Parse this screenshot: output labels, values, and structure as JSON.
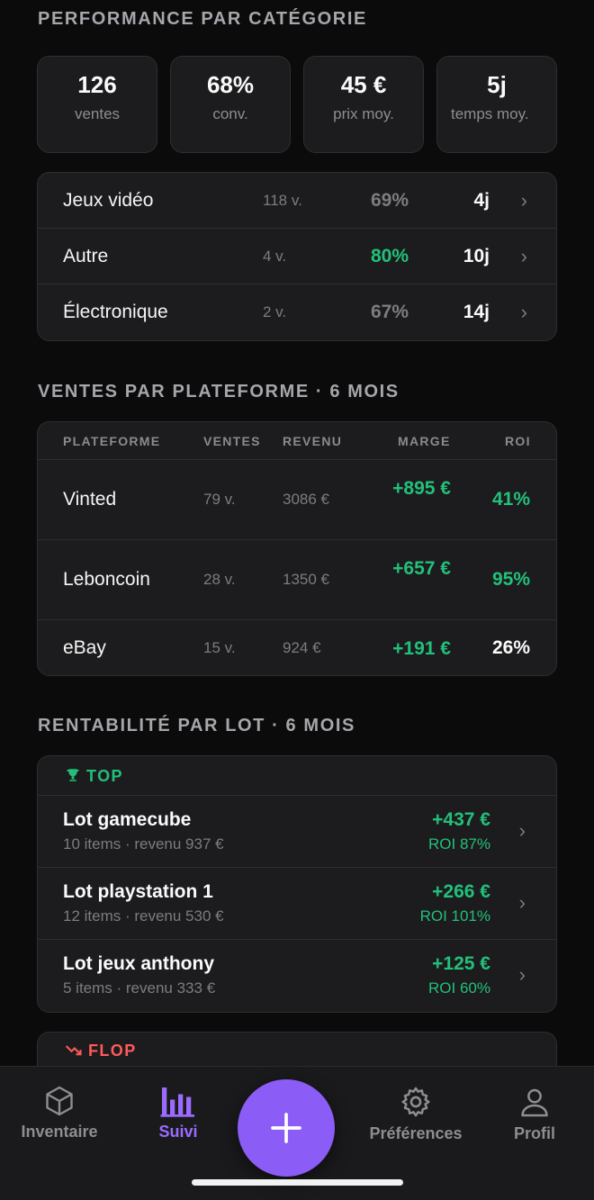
{
  "colors": {
    "accent": "#8b5cf6",
    "positive": "#22c07a",
    "negative": "#ff5a5a",
    "background": "#0b0b0c",
    "card": "#1c1c1e"
  },
  "perf": {
    "title": "PERFORMANCE PAR CATÉGORIE",
    "kpis": [
      {
        "value": "126",
        "label": "ventes"
      },
      {
        "value": "68%",
        "label": "conv."
      },
      {
        "value": "45 €",
        "label": "prix moy."
      },
      {
        "value": "5j",
        "label": "temps moy."
      }
    ],
    "categories": [
      {
        "name": "Jeux vidéo",
        "count": "118 v.",
        "pct": "69%",
        "days": "4j"
      },
      {
        "name": "Autre",
        "count": "4 v.",
        "pct": "80%",
        "days": "10j"
      },
      {
        "name": "Électronique",
        "count": "2 v.",
        "pct": "67%",
        "days": "14j"
      }
    ]
  },
  "platforms": {
    "title": "VENTES PAR PLATEFORME · 6 MOIS",
    "headers": {
      "platform": "PLATEFORME",
      "sales": "VENTES",
      "revenue": "REVENU",
      "margin": "MARGE",
      "roi": "ROI"
    },
    "rows": [
      {
        "name": "Vinted",
        "sales": "79 v.",
        "revenue": "3086 €",
        "margin": "+895 €",
        "roi": "41%"
      },
      {
        "name": "Leboncoin",
        "sales": "28 v.",
        "revenue": "1350 €",
        "margin": "+657 €",
        "roi": "95%"
      },
      {
        "name": "eBay",
        "sales": "15 v.",
        "revenue": "924 €",
        "margin": "+191 €",
        "roi": "26%"
      }
    ]
  },
  "lots": {
    "title": "RENTABILITÉ PAR LOT · 6 MOIS",
    "top_label": "TOP",
    "flop_label": "FLOP",
    "top": [
      {
        "name": "Lot gamecube",
        "sub": "10 items · revenu 937 €",
        "margin": "+437 €",
        "roi": "ROI 87%"
      },
      {
        "name": "Lot playstation 1",
        "sub": "12 items · revenu 530 €",
        "margin": "+266 €",
        "roi": "ROI 101%"
      },
      {
        "name": "Lot jeux anthony",
        "sub": "5 items · revenu 333 €",
        "margin": "+125 €",
        "roi": "ROI 60%"
      }
    ]
  },
  "tabbar": {
    "inventory": "Inventaire",
    "tracking": "Suivi",
    "preferences": "Préférences",
    "profile": "Profil"
  }
}
